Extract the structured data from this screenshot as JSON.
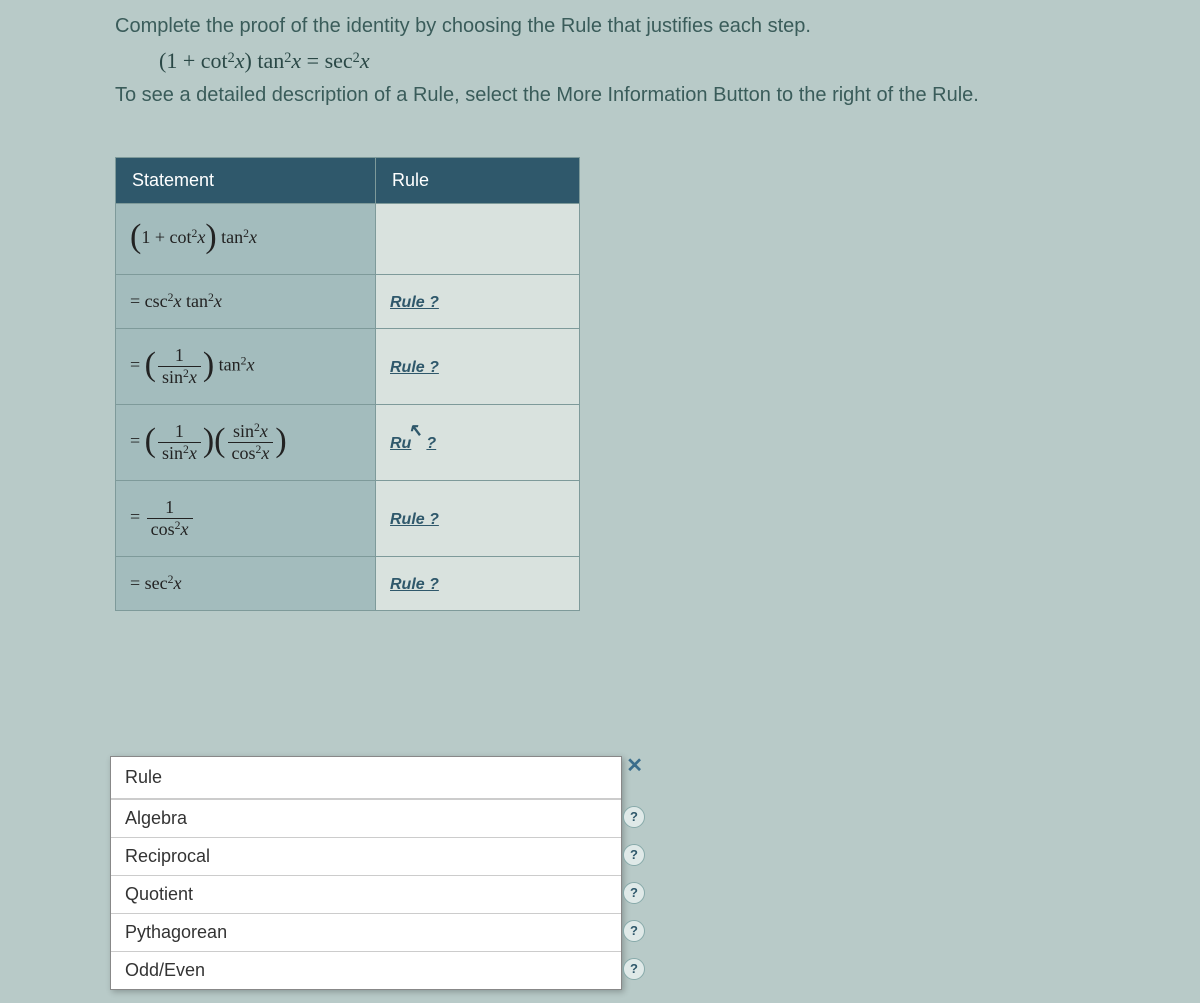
{
  "prompt": "Complete the proof of the identity by choosing the Rule that justifies each step.",
  "identity": "(1 + cot²x) tan²x = sec²x",
  "instruction": "To see a detailed description of a Rule, select the More Information Button to the right of the Rule.",
  "headers": {
    "statement": "Statement",
    "rule": "Rule"
  },
  "steps": {
    "s0": "(1 + cot²x) tan²x",
    "s1": "= csc²x tan²x",
    "s2": "= (1 / sin²x) tan²x",
    "s3": "= (1 / sin²x)(sin²x / cos²x)",
    "s4": "= 1 / cos²x",
    "s5": "= sec²x"
  },
  "rule_links": {
    "r1": "Rule ?",
    "r2": "Rule ?",
    "r3": "Rule ?",
    "r3_display": "Ru     ?",
    "r4": "Rule ?",
    "r5": "Rule ?"
  },
  "dropdown": {
    "title": "Rule",
    "close": "✕",
    "items": {
      "a": "Algebra",
      "b": "Reciprocal",
      "c": "Quotient",
      "d": "Pythagorean",
      "e": "Odd/Even"
    },
    "help": "?"
  }
}
